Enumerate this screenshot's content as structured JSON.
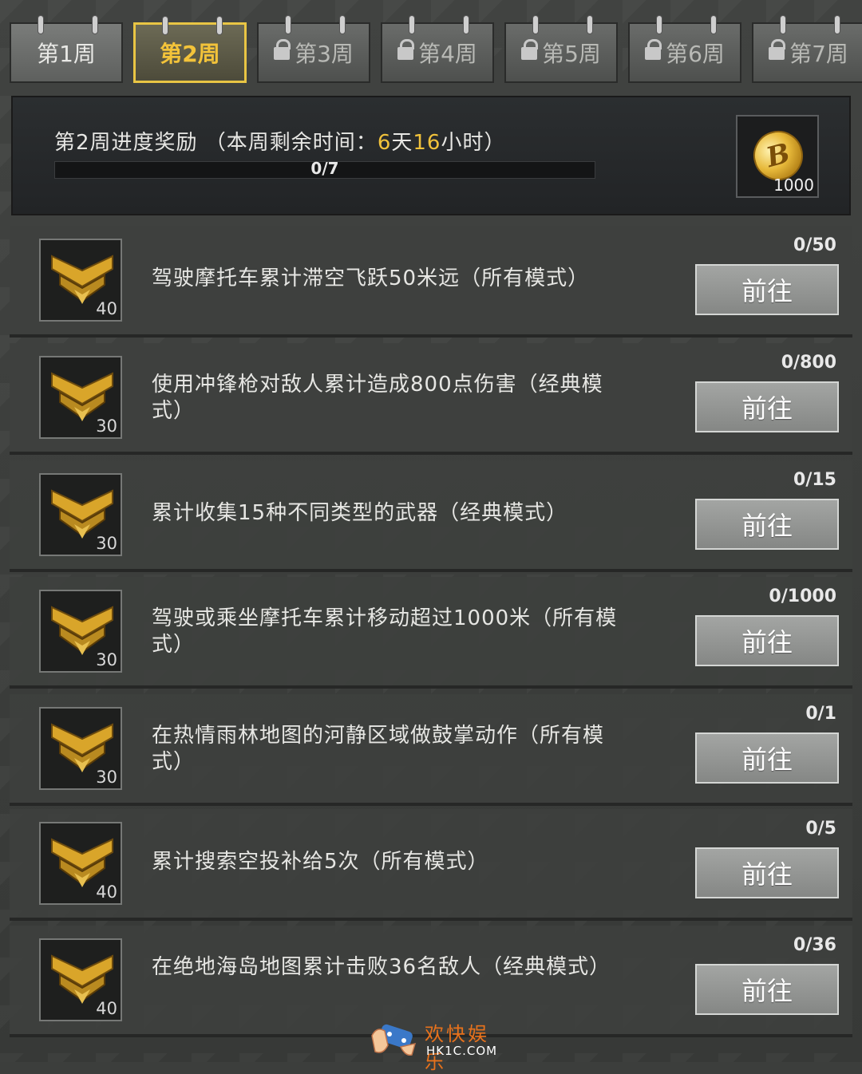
{
  "tabs": [
    {
      "label": "第1周",
      "locked": false,
      "active": false
    },
    {
      "label": "第2周",
      "locked": false,
      "active": true
    },
    {
      "label": "第3周",
      "locked": true,
      "active": false
    },
    {
      "label": "第4周",
      "locked": true,
      "active": false
    },
    {
      "label": "第5周",
      "locked": true,
      "active": false
    },
    {
      "label": "第6周",
      "locked": true,
      "active": false
    },
    {
      "label": "第7周",
      "locked": true,
      "active": false
    }
  ],
  "header": {
    "title_prefix": "第2周进度奖励 （本周剩余时间：",
    "days": "6",
    "days_unit": "天",
    "hours": "16",
    "hours_unit": "小时）",
    "progress_text": "0/7",
    "progress_fraction": 0,
    "reward_icon": "coin-icon",
    "reward_coin_symbol": "B",
    "reward_count": "1000"
  },
  "tasks": [
    {
      "points": "40",
      "desc": "驾驶摩托车累计滞空飞跃50米远（所有模式）",
      "progress": "0/50",
      "button": "前往"
    },
    {
      "points": "30",
      "desc": "使用冲锋枪对敌人累计造成800点伤害（经典模式）",
      "progress": "0/800",
      "button": "前往"
    },
    {
      "points": "30",
      "desc": "累计收集15种不同类型的武器（经典模式）",
      "progress": "0/15",
      "button": "前往"
    },
    {
      "points": "30",
      "desc": "驾驶或乘坐摩托车累计移动超过1000米（所有模式）",
      "progress": "0/1000",
      "button": "前往"
    },
    {
      "points": "30",
      "desc": "在热情雨林地图的河静区域做鼓掌动作（所有模式）",
      "progress": "0/1",
      "button": "前往"
    },
    {
      "points": "40",
      "desc": "累计搜索空投补给5次（所有模式）",
      "progress": "0/5",
      "button": "前往"
    },
    {
      "points": "40",
      "desc": "在绝地海岛地图累计击败36名敌人（经典模式）",
      "progress": "0/36",
      "button": "前往"
    }
  ],
  "watermark": {
    "cn": "欢快娱乐",
    "en": "HK1C.COM"
  },
  "colors": {
    "accent": "#f1c23b",
    "button": "#959795",
    "panel": "#3e403e"
  }
}
